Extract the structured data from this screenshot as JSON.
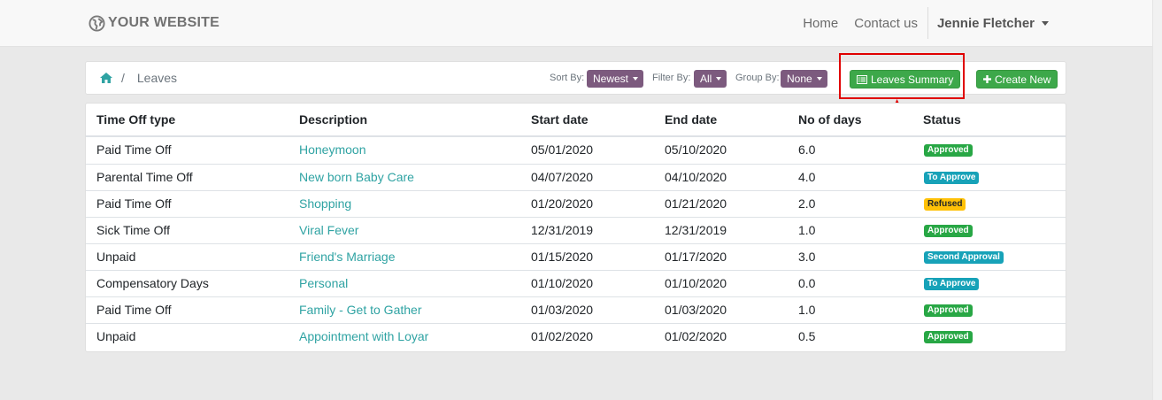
{
  "navbar": {
    "brand": "YOUR WEBSITE",
    "links": [
      "Home",
      "Contact us"
    ],
    "user": "Jennie Fletcher"
  },
  "breadcrumb": {
    "separator": "/",
    "current": "Leaves"
  },
  "controls": {
    "sort_label": "Sort By:",
    "sort_value": "Newest",
    "filter_label": "Filter By:",
    "filter_value": "All",
    "group_label": "Group By:",
    "group_value": "None",
    "summary_button": "Leaves Summary",
    "create_button": "Create New"
  },
  "table": {
    "headers": [
      "Time Off type",
      "Description",
      "Start date",
      "End date",
      "No of days",
      "Status"
    ],
    "rows": [
      {
        "type": "Paid Time Off",
        "description": "Honeymoon",
        "start": "05/01/2020",
        "end": "05/10/2020",
        "days": "6.0",
        "status": "Approved",
        "status_color": "#28a745"
      },
      {
        "type": "Parental Time Off",
        "description": "New born Baby Care",
        "start": "04/07/2020",
        "end": "04/10/2020",
        "days": "4.0",
        "status": "To Approve",
        "status_color": "#17a2b8"
      },
      {
        "type": "Paid Time Off",
        "description": "Shopping",
        "start": "01/20/2020",
        "end": "01/21/2020",
        "days": "2.0",
        "status": "Refused",
        "status_color": "#ffc107"
      },
      {
        "type": "Sick Time Off",
        "description": "Viral Fever",
        "start": "12/31/2019",
        "end": "12/31/2019",
        "days": "1.0",
        "status": "Approved",
        "status_color": "#28a745"
      },
      {
        "type": "Unpaid",
        "description": "Friend's Marriage",
        "start": "01/15/2020",
        "end": "01/17/2020",
        "days": "3.0",
        "status": "Second Approval",
        "status_color": "#17a2b8"
      },
      {
        "type": "Compensatory Days",
        "description": "Personal",
        "start": "01/10/2020",
        "end": "01/10/2020",
        "days": "0.0",
        "status": "To Approve",
        "status_color": "#17a2b8"
      },
      {
        "type": "Paid Time Off",
        "description": "Family - Get to Gather",
        "start": "01/03/2020",
        "end": "01/03/2020",
        "days": "1.0",
        "status": "Approved",
        "status_color": "#28a745"
      },
      {
        "type": "Unpaid",
        "description": "Appointment with Loyar",
        "start": "01/02/2020",
        "end": "01/02/2020",
        "days": "0.5",
        "status": "Approved",
        "status_color": "#28a745"
      }
    ]
  },
  "colors": {
    "accent_purple": "#7c5a7e",
    "button_green": "#3da84a",
    "link_teal": "#2fa3a3",
    "highlight_red": "#e00000"
  }
}
